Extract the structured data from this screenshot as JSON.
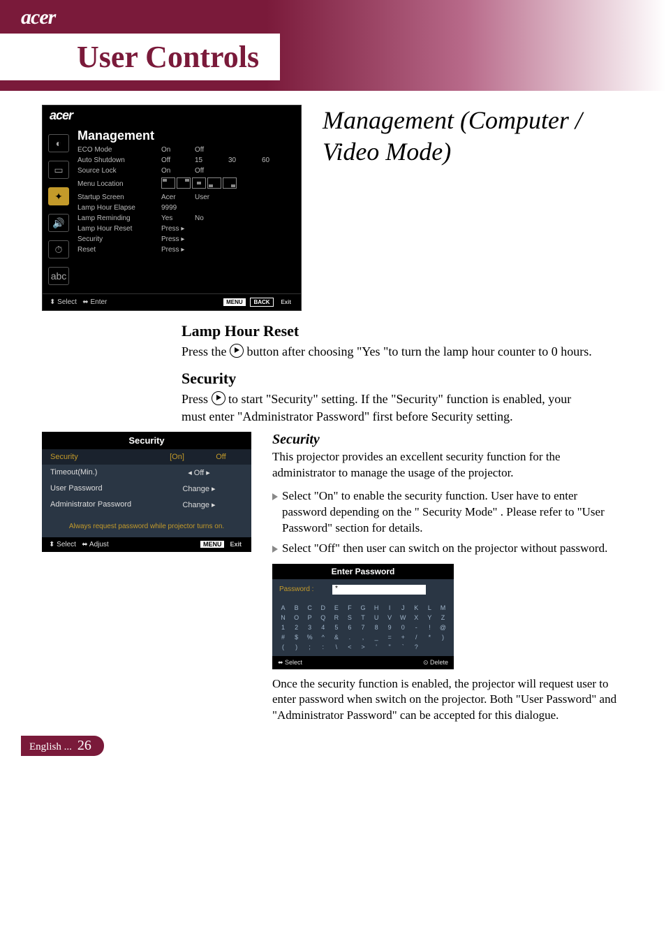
{
  "brand": "acer",
  "page_heading": "User Controls",
  "section_title": "Management (Computer / Video Mode)",
  "osd_main": {
    "brand": "acer",
    "title": "Management",
    "rows": {
      "eco_mode": {
        "label": "ECO Mode",
        "v1": "On",
        "v2": "Off"
      },
      "auto_shutdown": {
        "label": "Auto Shutdown",
        "v1": "Off",
        "v2": "15",
        "v3": "30",
        "v4": "60"
      },
      "source_lock": {
        "label": "Source Lock",
        "v1": "On",
        "v2": "Off"
      },
      "menu_location": {
        "label": "Menu Location"
      },
      "startup_screen": {
        "label": "Startup Screen",
        "v1": "Acer",
        "v2": "User"
      },
      "lamp_elapse": {
        "label": "Lamp Hour Elapse",
        "v1": "9999"
      },
      "lamp_remind": {
        "label": "Lamp Reminding",
        "v1": "Yes",
        "v2": "No"
      },
      "lamp_reset": {
        "label": "Lamp Hour Reset",
        "v1": "Press ▸"
      },
      "security": {
        "label": "Security",
        "v1": "Press ▸"
      },
      "reset": {
        "label": "Reset",
        "v1": "Press ▸"
      }
    },
    "bottom": {
      "select": "Select",
      "enter": "Enter",
      "menu": "MENU",
      "back": "BACK",
      "exit": "Exit"
    }
  },
  "lamp_reset": {
    "heading": "Lamp Hour Reset",
    "p_a": "Press the ",
    "p_b": " button after choosing \"Yes \"to turn the lamp hour counter to 0 hours."
  },
  "security_section": {
    "heading": "Security",
    "p_a": "Press ",
    "p_b": " to start \"Security\" setting. If the \"Security\" function is enabled, your must enter \"Administrator Password\" first before Security setting."
  },
  "osd_security": {
    "title": "Security",
    "row_sec": {
      "label": "Security",
      "on": "[On]",
      "off": "Off"
    },
    "row_timeout": {
      "label": "Timeout(Min.)",
      "val": "◂   Off   ▸"
    },
    "row_userpw": {
      "label": "User Password",
      "val": "Change ▸"
    },
    "row_adminpw": {
      "label": "Administrator Password",
      "val": "Change ▸"
    },
    "hint": "Always request password while projector turns on.",
    "bottom": {
      "select": "Select",
      "adjust": "Adjust",
      "menu": "MENU",
      "exit": "Exit"
    }
  },
  "right": {
    "sub": "Security",
    "p1": "This projector provides an excellent security function for the administrator to manage the usage of the projector.",
    "b1": "Select \"On\" to enable the security function. User have to enter password depending on the \" Security Mode\" . Please refer to \"User Password\" section for details.",
    "b2": "Select \"Off\" then user can switch on the projector without password.",
    "p2": "Once the security function is enabled, the projector will request user to enter password when switch on the projector. Both \"User Password\" and \"Administrator Password\" can be accepted for this dialogue."
  },
  "osd_password": {
    "title": "Enter Password",
    "label": "Password :",
    "value": "*",
    "keys": [
      "A",
      "B",
      "C",
      "D",
      "E",
      "F",
      "G",
      "H",
      "I",
      "J",
      "K",
      "L",
      "M",
      "N",
      "O",
      "P",
      "Q",
      "R",
      "S",
      "T",
      "U",
      "V",
      "W",
      "X",
      "Y",
      "Z",
      "1",
      "2",
      "3",
      "4",
      "5",
      "6",
      "7",
      "8",
      "9",
      "0",
      "-",
      "!",
      "@",
      "#",
      "$",
      "%",
      "^",
      "&",
      ".",
      ",",
      "_",
      "=",
      "+",
      "/",
      "*",
      ")",
      "(",
      ")",
      ";",
      ":",
      "\\",
      "<",
      ">",
      "'",
      "\"",
      "`",
      "?",
      " ",
      " "
    ],
    "bottom": {
      "select": "Select",
      "delete": "Delete"
    }
  },
  "footer": {
    "lang": "English ...",
    "page": "26"
  }
}
